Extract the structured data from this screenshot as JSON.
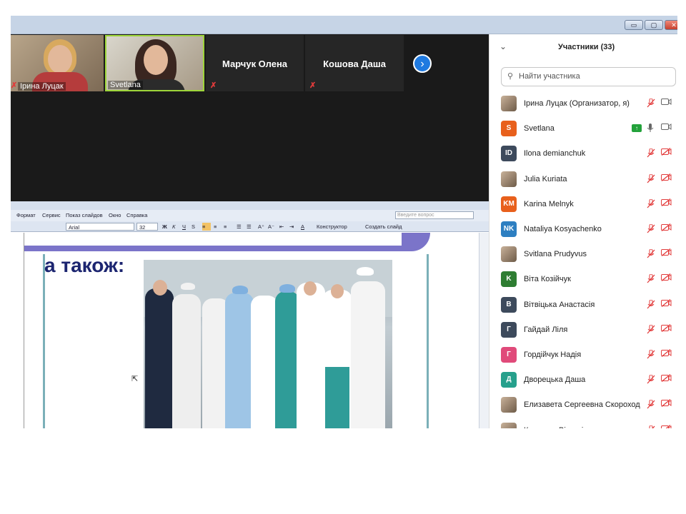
{
  "window": {
    "minimize_glyph": "▭",
    "maximize_glyph": "▢",
    "close_glyph": "✕"
  },
  "gallery": {
    "tiles": [
      {
        "name": "Ірина Луцак",
        "video": true
      },
      {
        "name": "Svetlana",
        "video": true,
        "active_speaker": true
      },
      {
        "name": "Марчук Олена",
        "video": false
      },
      {
        "name": "Кошова Даша",
        "video": false
      }
    ],
    "next_glyph": "›",
    "muted_glyph": "✗"
  },
  "ppt": {
    "menu": [
      "Формат",
      "Сервис",
      "Показ слайдов",
      "Окно",
      "Справка"
    ],
    "ask_placeholder": "Введите вопрос",
    "font": "Arial",
    "size": "32",
    "toolbar_designer": "Конструктор",
    "toolbar_new_slide": "Создать слайд",
    "slide_heading": "а також:"
  },
  "panel": {
    "title": "Участники (33)",
    "search_placeholder": "Найти участника",
    "collapse_glyph": "⌄",
    "search_glyph": "⚲",
    "participants": [
      {
        "name": "Ірина Луцак (Организатор, я)",
        "avatar": "",
        "avatar_color": "",
        "photo": true,
        "mic": "muted",
        "cam": "on"
      },
      {
        "name": "Svetlana",
        "avatar": "S",
        "avatar_color": "#e8601c",
        "photo": false,
        "mic": "on",
        "cam": "on",
        "sharing": true
      },
      {
        "name": "Ilona demianchuk",
        "avatar": "ID",
        "avatar_color": "#3d4a5c",
        "photo": false,
        "mic": "muted",
        "cam": "off"
      },
      {
        "name": "Julia Kuriata",
        "avatar": "",
        "avatar_color": "",
        "photo": true,
        "mic": "muted",
        "cam": "off"
      },
      {
        "name": "Karina Melnyk",
        "avatar": "KM",
        "avatar_color": "#e8601c",
        "photo": false,
        "mic": "muted",
        "cam": "off"
      },
      {
        "name": "Nataliya Kosyachenko",
        "avatar": "NK",
        "avatar_color": "#2d7fc1",
        "photo": false,
        "mic": "muted",
        "cam": "off"
      },
      {
        "name": "Svitlana Prudyvus",
        "avatar": "",
        "avatar_color": "",
        "photo": true,
        "mic": "muted",
        "cam": "off"
      },
      {
        "name": "Віта Козійчук",
        "avatar": "K",
        "avatar_color": "#2e7d32",
        "photo": false,
        "mic": "muted",
        "cam": "off"
      },
      {
        "name": "Вітвіцька Анастасія",
        "avatar": "В",
        "avatar_color": "#3d4a5c",
        "photo": false,
        "mic": "muted",
        "cam": "off"
      },
      {
        "name": "Гайдай Ліля",
        "avatar": "Г",
        "avatar_color": "#3d4a5c",
        "photo": false,
        "mic": "muted",
        "cam": "off"
      },
      {
        "name": "Гордійчук Надія",
        "avatar": "Г",
        "avatar_color": "#e04a7a",
        "photo": false,
        "mic": "muted",
        "cam": "off"
      },
      {
        "name": "Дворецька Даша",
        "avatar": "Д",
        "avatar_color": "#26a08c",
        "photo": false,
        "mic": "muted",
        "cam": "off"
      },
      {
        "name": "Елизавета Сергеевна Скороход",
        "avatar": "",
        "avatar_color": "",
        "photo": true,
        "mic": "muted",
        "cam": "off"
      },
      {
        "name": "Камешок Вікторія",
        "avatar": "",
        "avatar_color": "",
        "photo": true,
        "mic": "muted",
        "cam": "off"
      }
    ]
  },
  "icons": {
    "mic_muted": "🎙",
    "cam": "▭",
    "share": "↑"
  }
}
